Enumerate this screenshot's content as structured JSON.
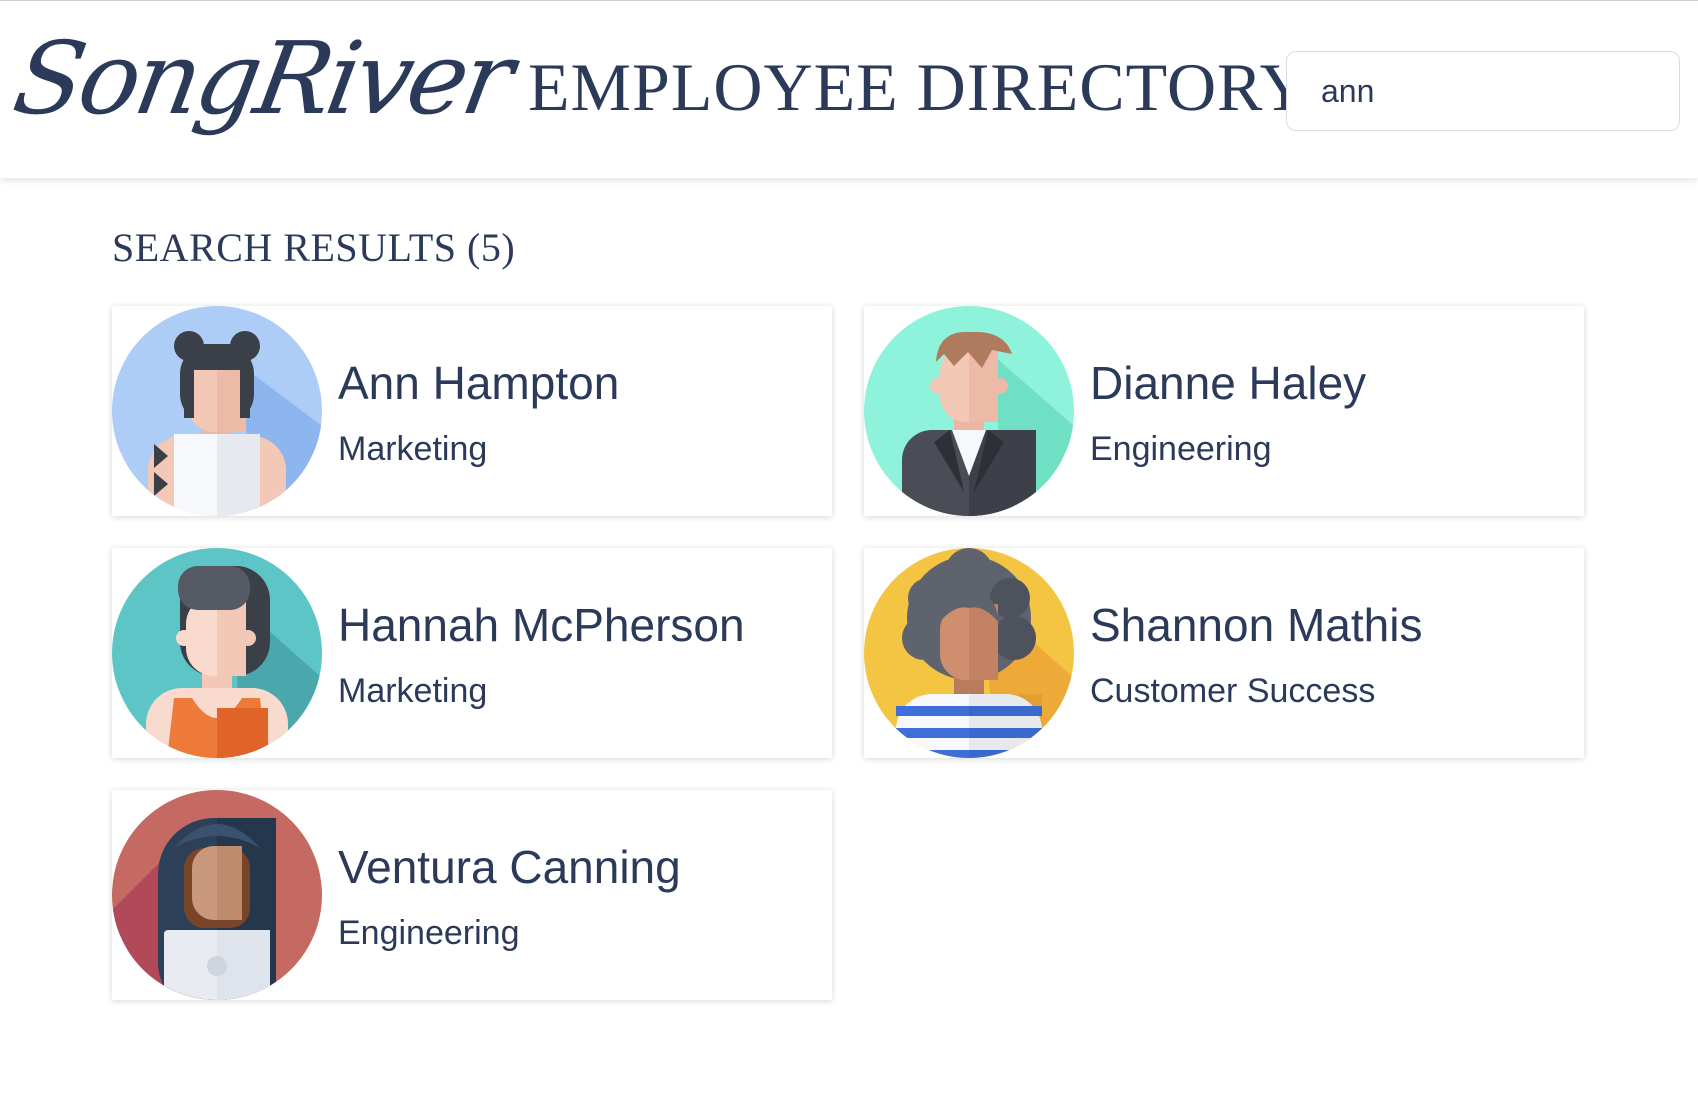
{
  "header": {
    "logo_text": "SongRiver",
    "title": "EMPLOYEE DIRECTORY"
  },
  "search": {
    "value": "ann"
  },
  "results": {
    "heading": "SEARCH RESULTS (5)",
    "employees": [
      {
        "name": "Ann Hampton",
        "department": "Marketing",
        "avatar_color": "#aecdf6"
      },
      {
        "name": "Dianne Haley",
        "department": "Engineering",
        "avatar_color": "#8ef3da"
      },
      {
        "name": "Hannah McPherson",
        "department": "Marketing",
        "avatar_color": "#5ec5c7"
      },
      {
        "name": "Shannon Mathis",
        "department": "Customer Success",
        "avatar_color": "#f4c542"
      },
      {
        "name": "Ventura Canning",
        "department": "Engineering",
        "avatar_color": "#c56a62"
      }
    ]
  },
  "colors": {
    "text": "#2c3a59",
    "card_bg": "#ffffff"
  }
}
